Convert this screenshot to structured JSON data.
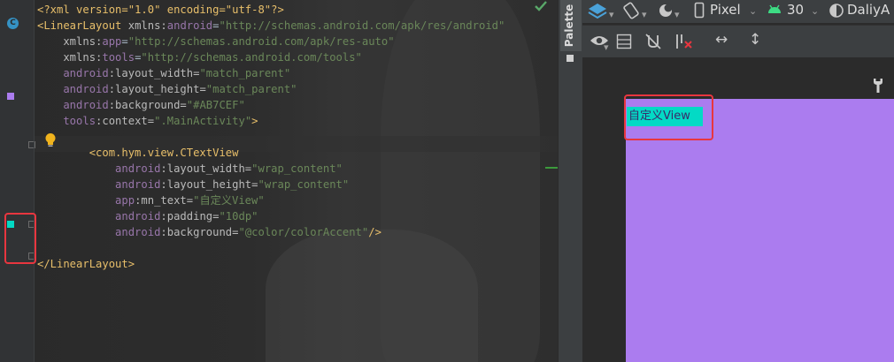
{
  "editor": {
    "lines": [
      {
        "segments": [
          {
            "t": "<?xml version=\"1.0\" encoding=\"utf-8\"?>",
            "c": "tag"
          }
        ]
      },
      {
        "segments": [
          {
            "t": "<LinearLayout ",
            "c": "tag"
          },
          {
            "t": "xmlns:",
            "c": "attr"
          },
          {
            "t": "android",
            "c": "ns"
          },
          {
            "t": "=",
            "c": "plain"
          },
          {
            "t": "\"http://schemas.android.com/apk/res/android\"",
            "c": "val"
          }
        ]
      },
      {
        "segments": [
          {
            "t": "    xmlns:",
            "c": "attr"
          },
          {
            "t": "app",
            "c": "ns"
          },
          {
            "t": "=",
            "c": "plain"
          },
          {
            "t": "\"http://schemas.android.com/apk/res-auto\"",
            "c": "val"
          }
        ]
      },
      {
        "segments": [
          {
            "t": "    xmlns:",
            "c": "attr"
          },
          {
            "t": "tools",
            "c": "ns"
          },
          {
            "t": "=",
            "c": "plain"
          },
          {
            "t": "\"http://schemas.android.com/tools\"",
            "c": "val"
          }
        ]
      },
      {
        "segments": [
          {
            "t": "    android",
            "c": "ns"
          },
          {
            "t": ":layout_width=",
            "c": "attr"
          },
          {
            "t": "\"match_parent\"",
            "c": "val"
          }
        ]
      },
      {
        "segments": [
          {
            "t": "    android",
            "c": "ns"
          },
          {
            "t": ":layout_height=",
            "c": "attr"
          },
          {
            "t": "\"match_parent\"",
            "c": "val"
          }
        ]
      },
      {
        "segments": [
          {
            "t": "    android",
            "c": "ns"
          },
          {
            "t": ":background=",
            "c": "attr"
          },
          {
            "t": "\"#AB7CEF\"",
            "c": "val"
          }
        ]
      },
      {
        "segments": [
          {
            "t": "    tools",
            "c": "ns"
          },
          {
            "t": ":context=",
            "c": "attr"
          },
          {
            "t": "\".MainActivity\"",
            "c": "val"
          },
          {
            "t": ">",
            "c": "tag"
          }
        ]
      },
      {
        "segments": []
      },
      {
        "segments": [
          {
            "t": "        <com.hym.view.CTextView",
            "c": "tag"
          }
        ]
      },
      {
        "segments": [
          {
            "t": "            android",
            "c": "ns"
          },
          {
            "t": ":layout_width=",
            "c": "attr"
          },
          {
            "t": "\"wrap_content\"",
            "c": "val"
          }
        ]
      },
      {
        "segments": [
          {
            "t": "            android",
            "c": "ns"
          },
          {
            "t": ":layout_height=",
            "c": "attr"
          },
          {
            "t": "\"wrap_content\"",
            "c": "val"
          }
        ]
      },
      {
        "segments": [
          {
            "t": "            app",
            "c": "ns"
          },
          {
            "t": ":mn_text=",
            "c": "attr"
          },
          {
            "t": "\"自定义View\"",
            "c": "val"
          }
        ]
      },
      {
        "segments": [
          {
            "t": "            android",
            "c": "ns"
          },
          {
            "t": ":padding=",
            "c": "attr"
          },
          {
            "t": "\"10dp\"",
            "c": "val"
          }
        ]
      },
      {
        "segments": [
          {
            "t": "            android",
            "c": "ns"
          },
          {
            "t": ":background=",
            "c": "attr"
          },
          {
            "t": "\"@color/colorAccent\"",
            "c": "val"
          },
          {
            "t": "/>",
            "c": "tag"
          }
        ]
      },
      {
        "segments": []
      },
      {
        "segments": [
          {
            "t": "</LinearLayout>",
            "c": "tag"
          }
        ]
      }
    ],
    "gutter_colors": {
      "background_swatch": "#AB7CEF",
      "accent_swatch": "#03DAC5",
      "class_icon": "#3592C4"
    },
    "gutter_class_glyph": "C"
  },
  "palette": {
    "label": "Palette"
  },
  "design_toolbar": {
    "device": "Pixel",
    "api_level": "30",
    "theme": "DaliyA",
    "icons": [
      "layers-icon",
      "orientation-icon",
      "night-mode-icon",
      "device-icon",
      "android-icon",
      "theme-icon"
    ],
    "view_icons": [
      "eye-icon",
      "blueprint-icon",
      "constraints-off-icon",
      "clear-constraints-icon",
      "expand-horizontal-icon",
      "expand-vertical-icon",
      "wrench-icon"
    ]
  },
  "preview": {
    "background": "#AB7CEF",
    "view_text": "自定义View",
    "view_background": "#03DAC5"
  }
}
